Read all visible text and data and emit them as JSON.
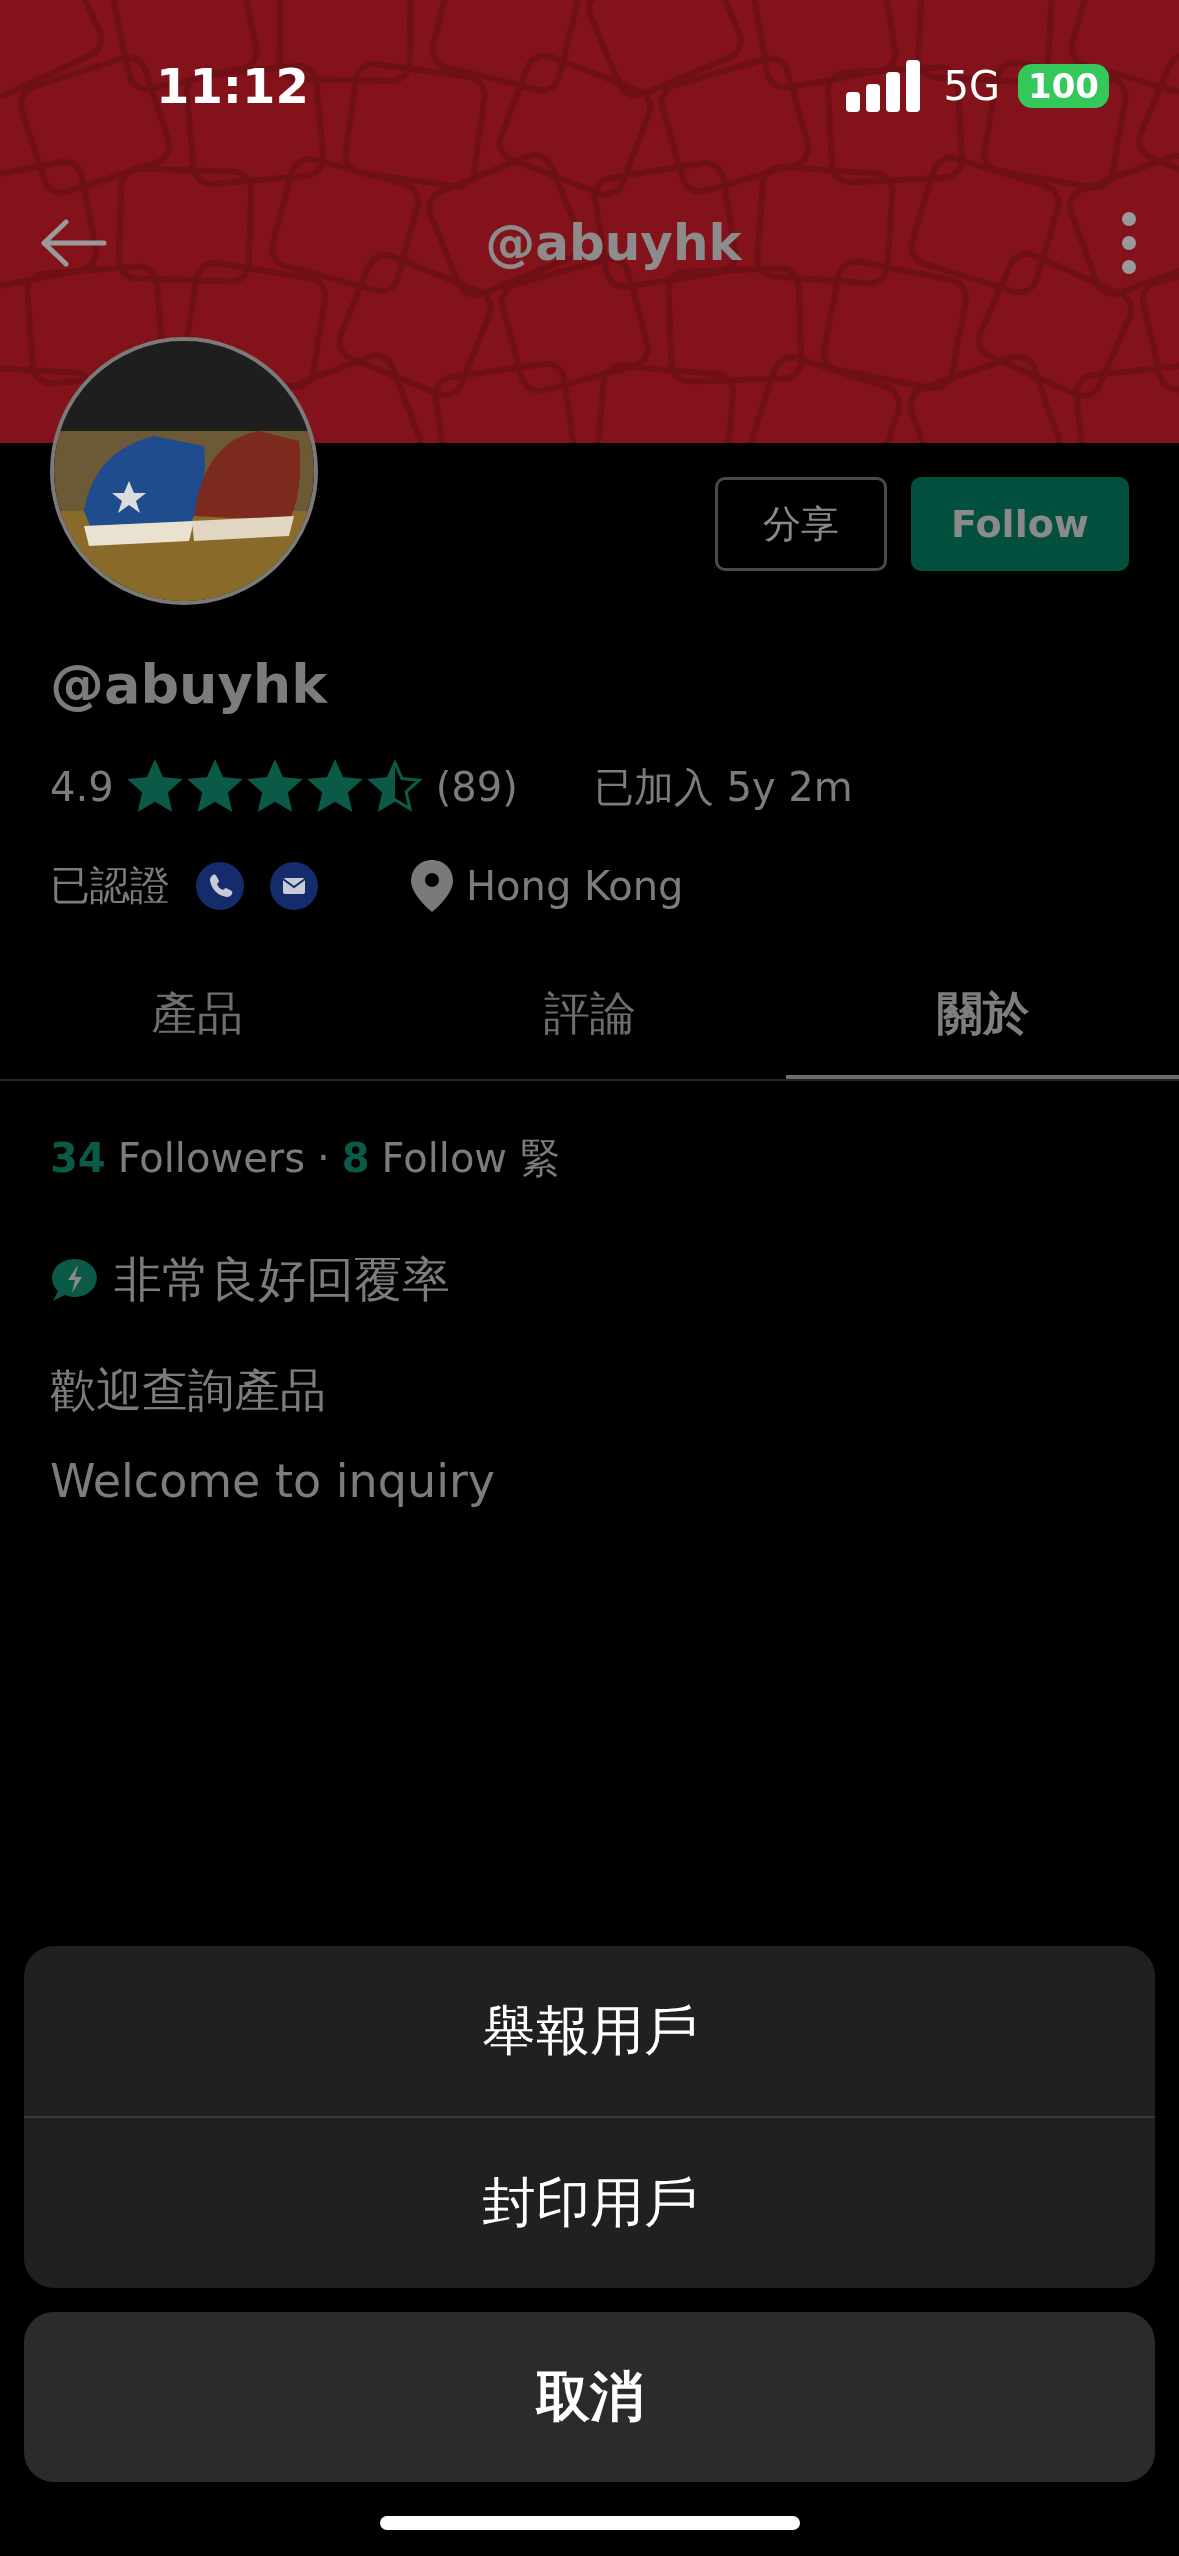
{
  "status_bar": {
    "time": "11:12",
    "network": "5G",
    "battery": "100"
  },
  "nav": {
    "title": "@abuyhk"
  },
  "profile": {
    "share_button": "分享",
    "follow_button": "Follow",
    "username": "@abuyhk",
    "rating": "4.9",
    "stars": 4.5,
    "review_count": "(89)",
    "joined": "已加入 5y 2m",
    "verified_label": "已認證",
    "location": "Hong Kong"
  },
  "tabs": [
    {
      "label": "產品",
      "selected": false
    },
    {
      "label": "評論",
      "selected": false
    },
    {
      "label": "關於",
      "selected": true
    }
  ],
  "about": {
    "followers_count": "34",
    "followers_label": "Followers",
    "separator": "·",
    "following_count": "8",
    "following_label": "Follow 緊",
    "response_badge": "非常良好回覆率",
    "description": [
      "歡迎查詢產品",
      "Welcome to inquiry"
    ]
  },
  "action_sheet": {
    "actions": [
      "舉報用戶",
      "封印用戶"
    ],
    "cancel": "取消"
  }
}
